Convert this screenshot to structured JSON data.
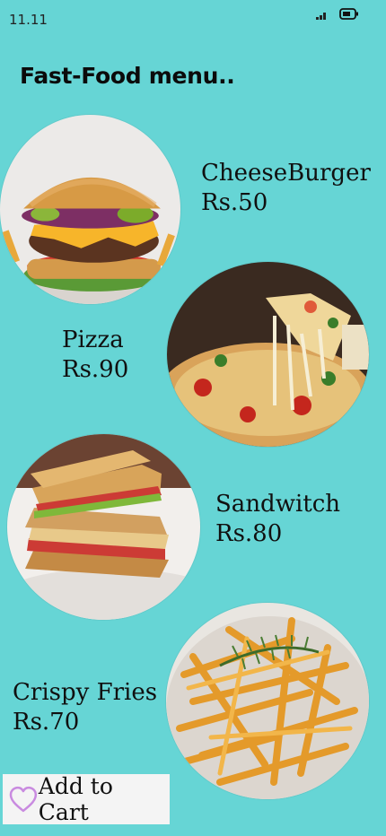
{
  "status": {
    "time": "11.11"
  },
  "header": {
    "title": "Fast-Food menu.."
  },
  "menu": {
    "items": [
      {
        "name": "CheeseBurger",
        "price": "Rs.50"
      },
      {
        "name": "Pizza",
        "price": "Rs.90"
      },
      {
        "name": "Sandwitch",
        "price": "Rs.80"
      },
      {
        "name": "Crispy Fries",
        "price": "Rs.70"
      }
    ]
  },
  "cart": {
    "label": "Add to Cart",
    "icon": "heart-outline-icon",
    "icon_color": "#c98be0"
  },
  "theme": {
    "background": "#66d5d5"
  }
}
